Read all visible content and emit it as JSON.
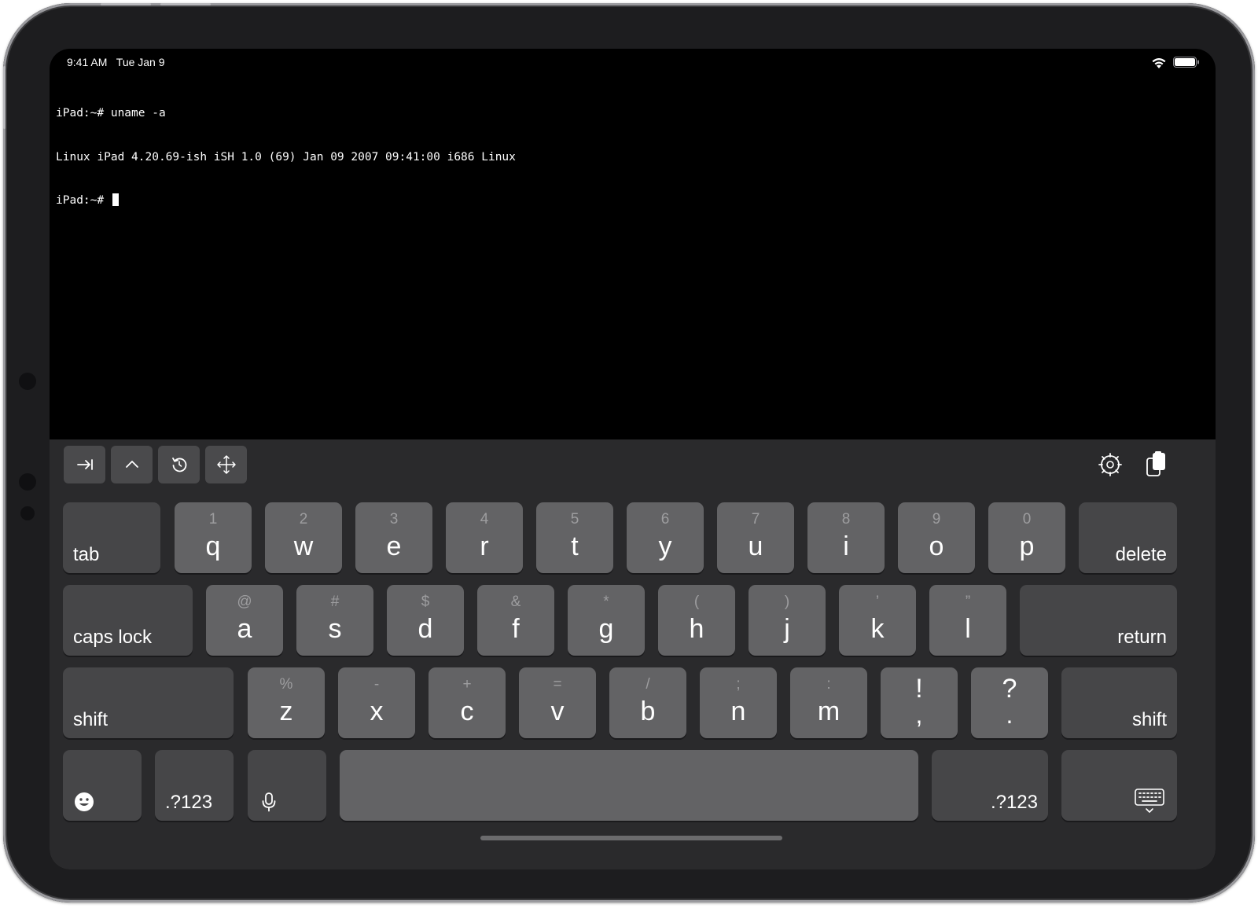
{
  "status_bar": {
    "time_date": "9:41 AM   Tue Jan 9"
  },
  "terminal": {
    "lines": [
      "iPad:~# uname -a",
      "Linux iPad 4.20.69-ish iSH 1.0 (69) Jan 09 2007 09:41:00 i686 Linux",
      "iPad:~# "
    ]
  },
  "toolbar": {
    "left_buttons": [
      "tab-arrow-icon",
      "control-caret-icon",
      "history-icon",
      "arrow-keys-icon"
    ],
    "right_icons": [
      "settings-icon",
      "paste-icon"
    ]
  },
  "keyboard": {
    "row1": {
      "tab": "tab",
      "keys": [
        {
          "main": "q",
          "sub": "1"
        },
        {
          "main": "w",
          "sub": "2"
        },
        {
          "main": "e",
          "sub": "3"
        },
        {
          "main": "r",
          "sub": "4"
        },
        {
          "main": "t",
          "sub": "5"
        },
        {
          "main": "y",
          "sub": "6"
        },
        {
          "main": "u",
          "sub": "7"
        },
        {
          "main": "i",
          "sub": "8"
        },
        {
          "main": "o",
          "sub": "9"
        },
        {
          "main": "p",
          "sub": "0"
        }
      ],
      "delete": "delete"
    },
    "row2": {
      "caps": "caps lock",
      "keys": [
        {
          "main": "a",
          "sub": "@"
        },
        {
          "main": "s",
          "sub": "#"
        },
        {
          "main": "d",
          "sub": "$"
        },
        {
          "main": "f",
          "sub": "&"
        },
        {
          "main": "g",
          "sub": "*"
        },
        {
          "main": "h",
          "sub": "("
        },
        {
          "main": "j",
          "sub": ")"
        },
        {
          "main": "k",
          "sub": "’"
        },
        {
          "main": "l",
          "sub": "”"
        }
      ],
      "return": "return"
    },
    "row3": {
      "shift": "shift",
      "keys": [
        {
          "main": "z",
          "sub": "%"
        },
        {
          "main": "x",
          "sub": "-"
        },
        {
          "main": "c",
          "sub": "+"
        },
        {
          "main": "v",
          "sub": "="
        },
        {
          "main": "b",
          "sub": "/"
        },
        {
          "main": "n",
          "sub": ";"
        },
        {
          "main": "m",
          "sub": ":"
        }
      ],
      "punct": [
        {
          "top": "!",
          "bottom": ","
        },
        {
          "top": "?",
          "bottom": "."
        }
      ],
      "shift_right": "shift"
    },
    "row4": {
      "numbers_left": ".?123",
      "numbers_right": ".?123"
    }
  },
  "colors": {
    "screen_bg": "#000000",
    "keyboard_bg": "#2a2a2c",
    "key_light": "#636365",
    "key_dark": "#464648"
  }
}
